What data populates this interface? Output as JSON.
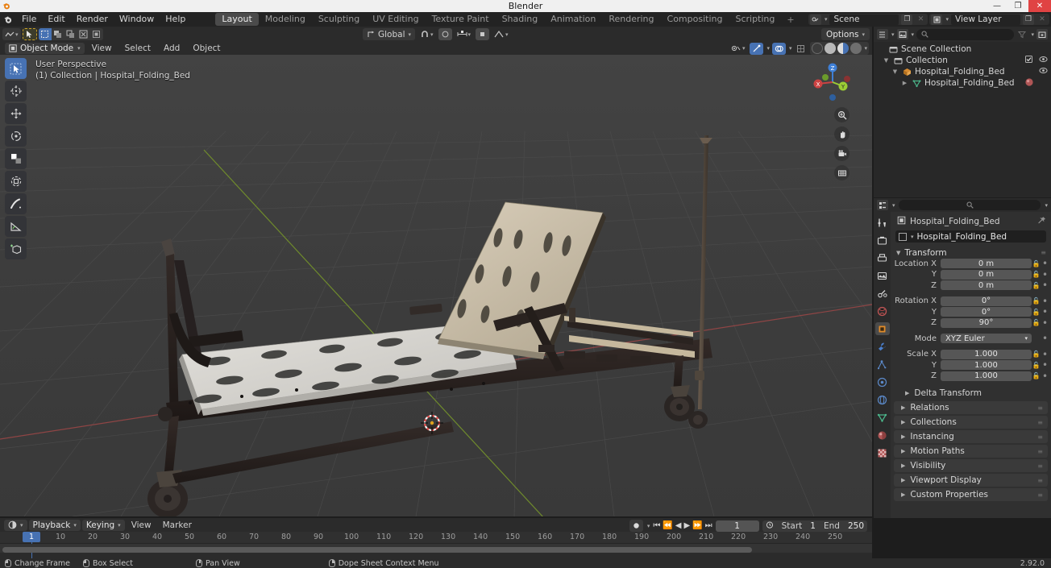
{
  "window": {
    "title": "Blender",
    "minimize_label": "—",
    "maximize_label": "❐",
    "close_label": "✕"
  },
  "topbar": {
    "menus": [
      "File",
      "Edit",
      "Render",
      "Window",
      "Help"
    ],
    "workspace_tabs": [
      "Layout",
      "Modeling",
      "Sculpting",
      "UV Editing",
      "Texture Paint",
      "Shading",
      "Animation",
      "Rendering",
      "Compositing",
      "Scripting"
    ],
    "active_workspace": "Layout",
    "add_workspace_label": "+",
    "scene_name": "Scene",
    "view_layer_name": "View Layer"
  },
  "viewport_header": {
    "transform_orientation": "Global",
    "options_label": "Options",
    "snap_icon": "magnet-icon",
    "proportional_icon": "proportional-edit-icon"
  },
  "mode_bar": {
    "mode": "Object Mode",
    "menus": [
      "View",
      "Select",
      "Add",
      "Object"
    ],
    "shading_modes": [
      "wireframe",
      "solid",
      "material-preview",
      "rendered"
    ],
    "active_shading": "material-preview"
  },
  "viewport": {
    "perspective_label": "User Perspective",
    "collection_label": "(1) Collection | Hospital_Folding_Bed",
    "gizmo_axes": [
      {
        "label": "X",
        "color": "#cc4242"
      },
      {
        "label": "Y",
        "color": "#9ccc34"
      },
      {
        "label": "Z",
        "color": "#3e7fd6"
      }
    ],
    "nav_buttons": [
      "zoom-icon",
      "pan-icon",
      "camera-icon",
      "orthographic-icon"
    ],
    "tools": [
      {
        "name": "tweak-select-tool",
        "active": true
      },
      {
        "name": "cursor-tool",
        "active": false
      },
      {
        "name": "move-tool",
        "active": false
      },
      {
        "name": "rotate-tool",
        "active": false
      },
      {
        "name": "scale-tool",
        "active": false
      },
      {
        "name": "transform-tool",
        "active": false
      },
      {
        "name": "annotate-tool",
        "active": false
      },
      {
        "name": "measure-tool",
        "active": false
      },
      {
        "name": "add-cube-tool",
        "active": false
      }
    ],
    "model": {
      "name": "Hospital_Folding_Bed",
      "platform_color": "#d7d5d0",
      "backrest_color": "#cdc2ad",
      "frame_color": "#272020",
      "accent_color": "#c9bda4"
    },
    "grid_color": "#4a4a4a",
    "axis_x_color": "#9c4a4a",
    "axis_y_color": "#7d9c35"
  },
  "outliner": {
    "filter_icon": "filter-icon",
    "search_placeholder": "",
    "rows": [
      {
        "label": "Scene Collection",
        "icon": "collection-icon",
        "depth": 0,
        "expandable": false,
        "checkbox": false,
        "eye": false
      },
      {
        "label": "Collection",
        "icon": "collection-icon",
        "depth": 1,
        "expandable": true,
        "checkbox": true,
        "eye": true
      },
      {
        "label": "Hospital_Folding_Bed",
        "icon": "object-icon",
        "depth": 2,
        "expandable": true,
        "checkbox": false,
        "eye": true
      },
      {
        "label": "Hospital_Folding_Bed",
        "icon": "mesh-data-icon",
        "depth": 3,
        "expandable": true,
        "checkbox": false,
        "eye": false,
        "material": true
      }
    ]
  },
  "properties": {
    "search_placeholder": "",
    "tabs": [
      "tool-icon",
      "render-icon",
      "output-icon",
      "view-layer-icon",
      "scene-icon",
      "world-icon",
      "object-icon",
      "modifier-icon",
      "particles-icon",
      "physics-icon",
      "constraints-icon",
      "data-icon",
      "material-icon",
      "texture-icon"
    ],
    "active_tab": "object-icon",
    "breadcrumb_label": "Hospital_Folding_Bed",
    "object_name": "Hospital_Folding_Bed",
    "transform_panel_label": "Transform",
    "location": {
      "label": "Location X",
      "x": "0 m",
      "y": "0 m",
      "z": "0 m"
    },
    "rotation": {
      "label": "Rotation X",
      "x": "0°",
      "y": "0°",
      "z": "90°"
    },
    "rotation_mode": {
      "label": "Mode",
      "value": "XYZ Euler"
    },
    "scale": {
      "label": "Scale X",
      "x": "1.000",
      "y": "1.000",
      "z": "1.000"
    },
    "axis_y_label": "Y",
    "axis_z_label": "Z",
    "sub_panel": "Delta Transform",
    "closed_panels": [
      "Relations",
      "Collections",
      "Instancing",
      "Motion Paths",
      "Visibility",
      "Viewport Display",
      "Custom Properties"
    ]
  },
  "timeline": {
    "playback_label": "Playback",
    "keying_label": "Keying",
    "view_label": "View",
    "marker_label": "Marker",
    "current_frame": "1",
    "start_label": "Start",
    "start_value": "1",
    "end_label": "End",
    "end_value": "250",
    "playhead_frame": "1",
    "ticks": [
      "10",
      "20",
      "30",
      "40",
      "50",
      "60",
      "70",
      "80",
      "90",
      "100",
      "110",
      "120",
      "130",
      "140",
      "150",
      "160",
      "170",
      "180",
      "190",
      "200",
      "210",
      "220",
      "230",
      "240",
      "250"
    ],
    "transport_icons": [
      "jump-to-start",
      "prev-keyframe",
      "play-reverse",
      "play",
      "next-keyframe",
      "jump-to-end"
    ],
    "record_icon": "record-icon"
  },
  "statusbar": {
    "items": [
      {
        "mouse": "left",
        "label": "Change Frame"
      },
      {
        "mouse": "left",
        "label": "Box Select"
      },
      {
        "mouse": "middle",
        "label": "Pan View"
      },
      {
        "mouse": "right",
        "label": "Dope Sheet Context Menu"
      }
    ],
    "version": "2.92.0"
  }
}
